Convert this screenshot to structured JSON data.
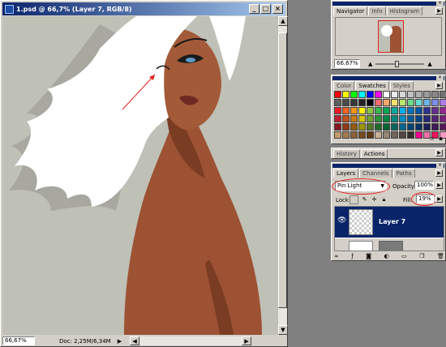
{
  "document": {
    "title": "1.psd @ 66,7% (Layer 7, RGB/8)",
    "zoom": "66,67%",
    "doc_size": "Doc: 2,25M/6,34M"
  },
  "navigator": {
    "tabs": [
      "Navigator",
      "Info",
      "Histogram"
    ],
    "zoom": "66.67%"
  },
  "swatches": {
    "tabs": [
      "Color",
      "Swatches",
      "Styles"
    ],
    "colors": [
      "#ff0000",
      "#ffff00",
      "#00ff00",
      "#00ffff",
      "#0000ff",
      "#ff00ff",
      "#ffffff",
      "#ebebeb",
      "#d7d7d7",
      "#c3c3c3",
      "#afafaf",
      "#9b9b9b",
      "#878787",
      "#737373",
      "#5f5f5f",
      "#4b4b4b",
      "#373737",
      "#232323",
      "#000000",
      "#f26b6b",
      "#f5a86b",
      "#fbe26b",
      "#b7e86b",
      "#6bd88c",
      "#6bdad2",
      "#6bb5e8",
      "#7c8ee8",
      "#a87ce0",
      "#ed1c24",
      "#f26522",
      "#f7941d",
      "#fff200",
      "#8dc63f",
      "#39b54a",
      "#00a651",
      "#00a99d",
      "#00aeef",
      "#0072bc",
      "#0054a6",
      "#2e3192",
      "#662d91",
      "#92278f",
      "#be1e2d",
      "#c1501c",
      "#c87b16",
      "#d4c800",
      "#72a032",
      "#2e923b",
      "#008643",
      "#00887f",
      "#008dc2",
      "#005c99",
      "#004486",
      "#262876",
      "#532475",
      "#76207a",
      "#8c1520",
      "#8f3b15",
      "#945b10",
      "#9c9400",
      "#557627",
      "#226c2c",
      "#006332",
      "#00655e",
      "#00688f",
      "#004472",
      "#003263",
      "#1b1d58",
      "#3d1b57",
      "#57175a",
      "#c69c6d",
      "#a67c52",
      "#8c6239",
      "#754c24",
      "#603913",
      "#c7b299",
      "#998675",
      "#736357",
      "#534741",
      "#362f2d",
      "#ec008c",
      "#f06eaa",
      "#ed145b",
      "#f49ac2"
    ]
  },
  "history": {
    "tabs": [
      "History",
      "Actions"
    ]
  },
  "layers": {
    "tabs": [
      "Layers",
      "Channels",
      "Paths"
    ],
    "blend_mode": "Pin Light",
    "opacity_label": "Opacity:",
    "opacity": "100%",
    "lock_label": "Lock:",
    "fill_label": "Fill:",
    "fill": "19%",
    "active_layer": "Layer 7"
  },
  "colors": {
    "accent": "#0a246a",
    "annotation_red": "#e02020",
    "canvas_bg": "#bfc0b6"
  }
}
